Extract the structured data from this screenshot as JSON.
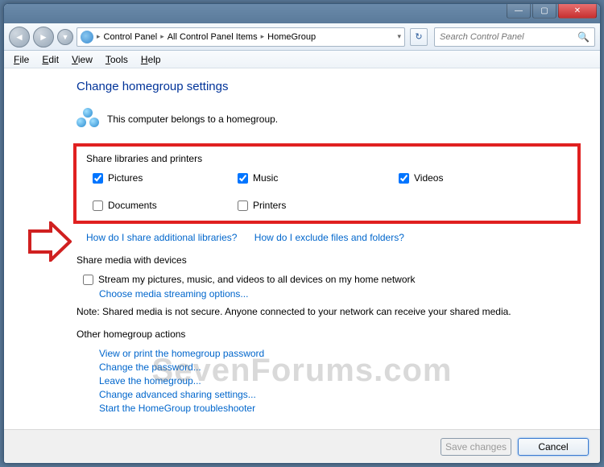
{
  "titlebar": {
    "min": "—",
    "max": "▢",
    "close": "✕"
  },
  "nav": {
    "back": "◄",
    "forward": "►",
    "drop": "▼"
  },
  "breadcrumb": {
    "sep": "▸",
    "p1": "Control Panel",
    "p2": "All Control Panel Items",
    "p3": "HomeGroup",
    "drop": "▾",
    "refresh": "↻"
  },
  "search": {
    "placeholder": "Search Control Panel"
  },
  "menu": {
    "file": "File",
    "edit": "Edit",
    "view": "View",
    "tools": "Tools",
    "help": "Help"
  },
  "page": {
    "title": "Change homegroup settings",
    "belongs": "This computer belongs to a homegroup.",
    "share_section": "Share libraries and printers",
    "checks": {
      "pictures": "Pictures",
      "music": "Music",
      "videos": "Videos",
      "documents": "Documents",
      "printers": "Printers"
    },
    "link_additional": "How do I share additional libraries?",
    "link_exclude": "How do I exclude files and folders?",
    "media_section": "Share media with devices",
    "stream": "Stream my pictures, music, and videos to all devices on my home network",
    "choose_media": "Choose media streaming options...",
    "note": "Note: Shared media is not secure. Anyone connected to your network can receive your shared media.",
    "other_section": "Other homegroup actions",
    "other_links": {
      "view_pw": "View or print the homegroup password",
      "change_pw": "Change the password...",
      "leave": "Leave the homegroup...",
      "advanced": "Change advanced sharing settings...",
      "troubleshoot": "Start the HomeGroup troubleshooter"
    }
  },
  "footer": {
    "save": "Save changes",
    "cancel": "Cancel"
  },
  "watermark": "SevenForums.com"
}
